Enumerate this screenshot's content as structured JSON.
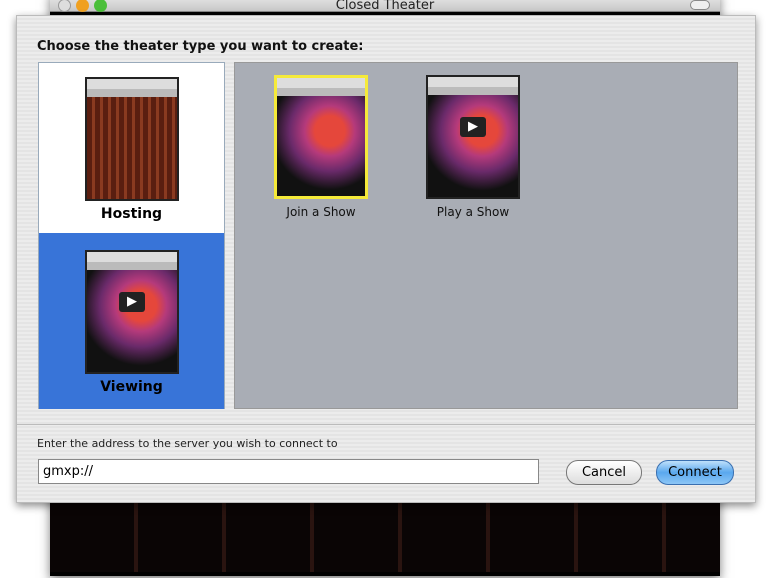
{
  "window": {
    "title": "Closed Theater"
  },
  "sheet": {
    "prompt": "Choose the theater type you want to create:",
    "types": [
      {
        "label": "Hosting",
        "selected": false
      },
      {
        "label": "Viewing",
        "selected": true
      }
    ],
    "items": [
      {
        "label": "Join a Show",
        "selected": true
      },
      {
        "label": "Play a Show",
        "selected": false
      }
    ],
    "address_label": "Enter the address to the server you wish to connect to",
    "address_value": "gmxp://",
    "cancel_label": "Cancel",
    "connect_label": "Connect"
  },
  "colors": {
    "selection": "#3874d8",
    "panel": "#a9adb5",
    "highlight": "#f5ea3a"
  }
}
